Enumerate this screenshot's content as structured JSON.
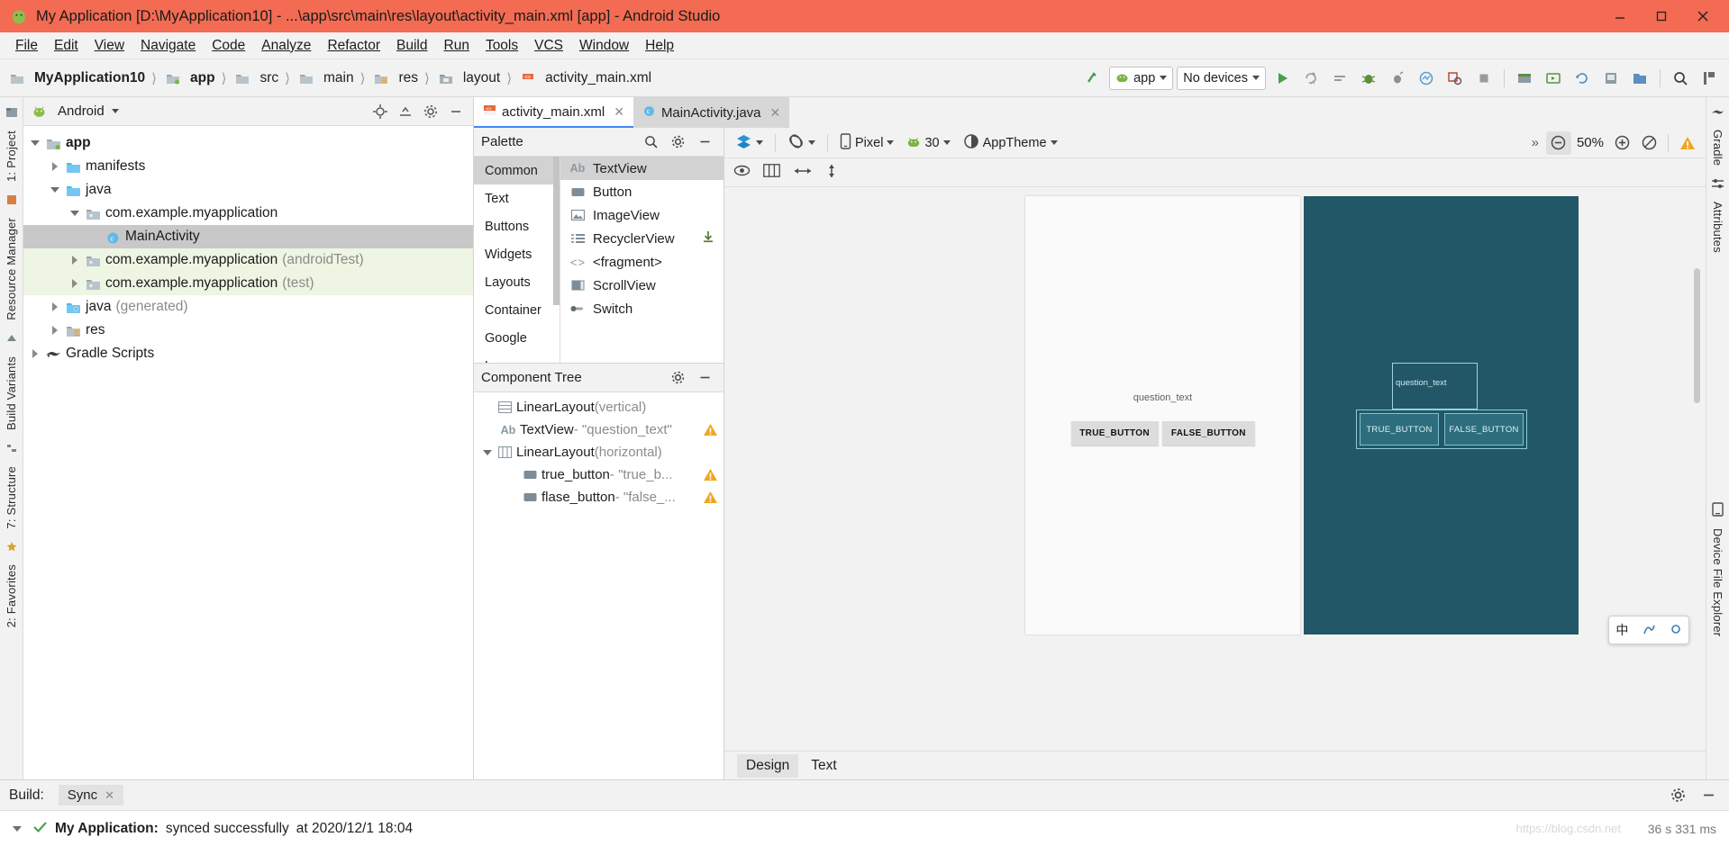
{
  "window": {
    "title": "My Application [D:\\MyApplication10] - ...\\app\\src\\main\\res\\layout\\activity_main.xml [app] - Android Studio",
    "minimize": "minimize-icon",
    "maximize": "maximize-icon",
    "close": "close-icon"
  },
  "menubar": [
    {
      "label": "File"
    },
    {
      "label": "Edit"
    },
    {
      "label": "View"
    },
    {
      "label": "Navigate"
    },
    {
      "label": "Code"
    },
    {
      "label": "Analyze"
    },
    {
      "label": "Refactor"
    },
    {
      "label": "Build"
    },
    {
      "label": "Run"
    },
    {
      "label": "Tools"
    },
    {
      "label": "VCS"
    },
    {
      "label": "Window"
    },
    {
      "label": "Help"
    }
  ],
  "breadcrumb": [
    {
      "label": "MyApplication10",
      "icon": "module-icon",
      "bold": true
    },
    {
      "label": "app",
      "icon": "app-module-icon",
      "bold": true
    },
    {
      "label": "src",
      "icon": "folder-icon",
      "bold": false
    },
    {
      "label": "main",
      "icon": "folder-icon",
      "bold": false
    },
    {
      "label": "res",
      "icon": "res-folder-icon",
      "bold": false
    },
    {
      "label": "layout",
      "icon": "layout-folder-icon",
      "bold": false
    },
    {
      "label": "activity_main.xml",
      "icon": "xml-file-icon",
      "bold": false
    }
  ],
  "toolbar": {
    "run_config": "app",
    "device": "No devices",
    "run_tooltip": "Run",
    "icons": [
      "make-project-icon",
      "run-icon",
      "apply-changes-icon",
      "debug-icon",
      "profile-icon",
      "attach-debugger-icon",
      "android-profiler-icon",
      "layout-inspector-icon",
      "stop-icon",
      "sdk-manager-icon",
      "avd-manager-icon",
      "sync-gradle-icon",
      "device-file-icon",
      "search-everywhere-icon",
      "project-structure-icon"
    ]
  },
  "project_panel": {
    "title": "Android",
    "actions": [
      "locate-icon",
      "collapse-all-icon",
      "settings-icon",
      "hide-icon"
    ],
    "tree": [
      {
        "label": "app",
        "indent": 0,
        "arrow": "down",
        "icon": "app-module-icon",
        "bold": true,
        "dim": "",
        "state": "normal"
      },
      {
        "label": "manifests",
        "indent": 1,
        "arrow": "right",
        "icon": "folder-blue-icon",
        "bold": false,
        "dim": "",
        "state": "normal"
      },
      {
        "label": "java",
        "indent": 1,
        "arrow": "down",
        "icon": "folder-blue-icon",
        "bold": false,
        "dim": "",
        "state": "normal"
      },
      {
        "label": "com.example.myapplication",
        "indent": 2,
        "arrow": "down",
        "icon": "package-icon",
        "bold": false,
        "dim": "",
        "state": "normal"
      },
      {
        "label": "MainActivity",
        "indent": 3,
        "arrow": "none",
        "icon": "class-icon",
        "bold": false,
        "dim": "",
        "state": "selected"
      },
      {
        "label": "com.example.myapplication",
        "indent": 2,
        "arrow": "right",
        "icon": "package-icon",
        "bold": false,
        "dim": "(androidTest)",
        "state": "test"
      },
      {
        "label": "com.example.myapplication",
        "indent": 2,
        "arrow": "right",
        "icon": "package-icon",
        "bold": false,
        "dim": "(test)",
        "state": "test"
      },
      {
        "label": "java",
        "indent": 1,
        "arrow": "right",
        "icon": "folder-generated-icon",
        "bold": false,
        "dim": "(generated)",
        "state": "normal"
      },
      {
        "label": "res",
        "indent": 1,
        "arrow": "right",
        "icon": "res-folder-icon",
        "bold": false,
        "dim": "",
        "state": "normal"
      },
      {
        "label": "Gradle Scripts",
        "indent": 0,
        "arrow": "right",
        "icon": "gradle-icon",
        "bold": false,
        "dim": "",
        "state": "normal"
      }
    ]
  },
  "left_tool_tabs": [
    {
      "label": "1: Project"
    },
    {
      "label": "Resource Manager"
    },
    {
      "label": "Build Variants"
    },
    {
      "label": "7: Structure"
    },
    {
      "label": "2: Favorites"
    }
  ],
  "right_tool_tabs": [
    {
      "label": "Gradle"
    },
    {
      "label": "Attributes"
    },
    {
      "label": "Device File Explorer"
    }
  ],
  "editor_tabs": [
    {
      "label": "activity_main.xml",
      "icon": "xml-file-icon",
      "active": true
    },
    {
      "label": "MainActivity.java",
      "icon": "java-class-icon",
      "active": false
    }
  ],
  "palette": {
    "title": "Palette",
    "actions": [
      "search-icon",
      "settings-icon",
      "hide-icon"
    ],
    "categories": [
      {
        "label": "Common",
        "selected": true
      },
      {
        "label": "Text",
        "selected": false
      },
      {
        "label": "Buttons",
        "selected": false
      },
      {
        "label": "Widgets",
        "selected": false
      },
      {
        "label": "Layouts",
        "selected": false
      },
      {
        "label": "Container",
        "selected": false
      },
      {
        "label": "Google",
        "selected": false
      },
      {
        "label": "Legacy",
        "selected": false
      }
    ],
    "items": [
      {
        "label": "TextView",
        "icon": "textview-icon",
        "selected": true,
        "download": false
      },
      {
        "label": "Button",
        "icon": "button-icon",
        "selected": false,
        "download": false
      },
      {
        "label": "ImageView",
        "icon": "imageview-icon",
        "selected": false,
        "download": false
      },
      {
        "label": "RecyclerView",
        "icon": "recyclerview-icon",
        "selected": false,
        "download": true
      },
      {
        "label": "<fragment>",
        "icon": "fragment-icon",
        "selected": false,
        "download": false
      },
      {
        "label": "ScrollView",
        "icon": "scrollview-icon",
        "selected": false,
        "download": false
      },
      {
        "label": "Switch",
        "icon": "switch-icon",
        "selected": false,
        "download": false
      }
    ]
  },
  "component_tree": {
    "title": "Component Tree",
    "actions": [
      "settings-icon",
      "hide-icon"
    ],
    "nodes": [
      {
        "name": "LinearLayout",
        "suffix": "(vertical)",
        "value": "",
        "indent": 0,
        "arrow": "none",
        "icon": "linearlayout-vertical-icon",
        "warning": false
      },
      {
        "name": "TextView",
        "suffix": "",
        "value": "- \"question_text\"",
        "indent": 1,
        "arrow": "none",
        "icon": "textview-icon",
        "warning": true
      },
      {
        "name": "LinearLayout",
        "suffix": "(horizontal)",
        "value": "",
        "indent": 1,
        "arrow": "down",
        "icon": "linearlayout-horizontal-icon",
        "warning": false
      },
      {
        "name": "true_button",
        "suffix": "",
        "value": "- \"true_b...",
        "indent": 2,
        "arrow": "none",
        "icon": "button-icon",
        "warning": true
      },
      {
        "name": "flase_button",
        "suffix": "",
        "value": "- \"false_...",
        "indent": 2,
        "arrow": "none",
        "icon": "button-icon",
        "warning": true
      }
    ]
  },
  "design_toolbar": {
    "design_mode": "design-surface-icon",
    "orientation": "orientation-icon",
    "device": "Pixel",
    "api_level": "30",
    "theme": "AppTheme",
    "overflow": "»",
    "zoom_out": "zoom-out-icon",
    "zoom_level": "50%",
    "zoom_in": "zoom-in-icon",
    "zoom_fit": "zoom-fit-icon",
    "warning": "warning-icon"
  },
  "design_toolbar2": {
    "eye": "show-hide-icon",
    "columns": "blueprint-mode-icon",
    "h_arrow": "horizontal-constraint-icon",
    "v_arrow": "vertical-constraint-icon"
  },
  "preview": {
    "question_text": "question_text",
    "true_button": "TRUE_BUTTON",
    "false_button": "FALSE_BUTTON"
  },
  "ime": {
    "lang": "中",
    "mode": "handwriting-icon",
    "dot": "ime-dot-icon"
  },
  "bottom_tabs": [
    {
      "label": "Design",
      "selected": true
    },
    {
      "label": "Text",
      "selected": false
    }
  ],
  "build_panel": {
    "label": "Build:",
    "tab": "Sync",
    "tab_close": "close-icon",
    "actions": [
      "settings-icon",
      "hide-icon"
    ],
    "message_bold": "My Application:",
    "message": "synced successfully",
    "message_time": "at 2020/12/1 18:04",
    "duration": "36 s 331 ms",
    "watermark": "https://blog.csdn.net"
  }
}
